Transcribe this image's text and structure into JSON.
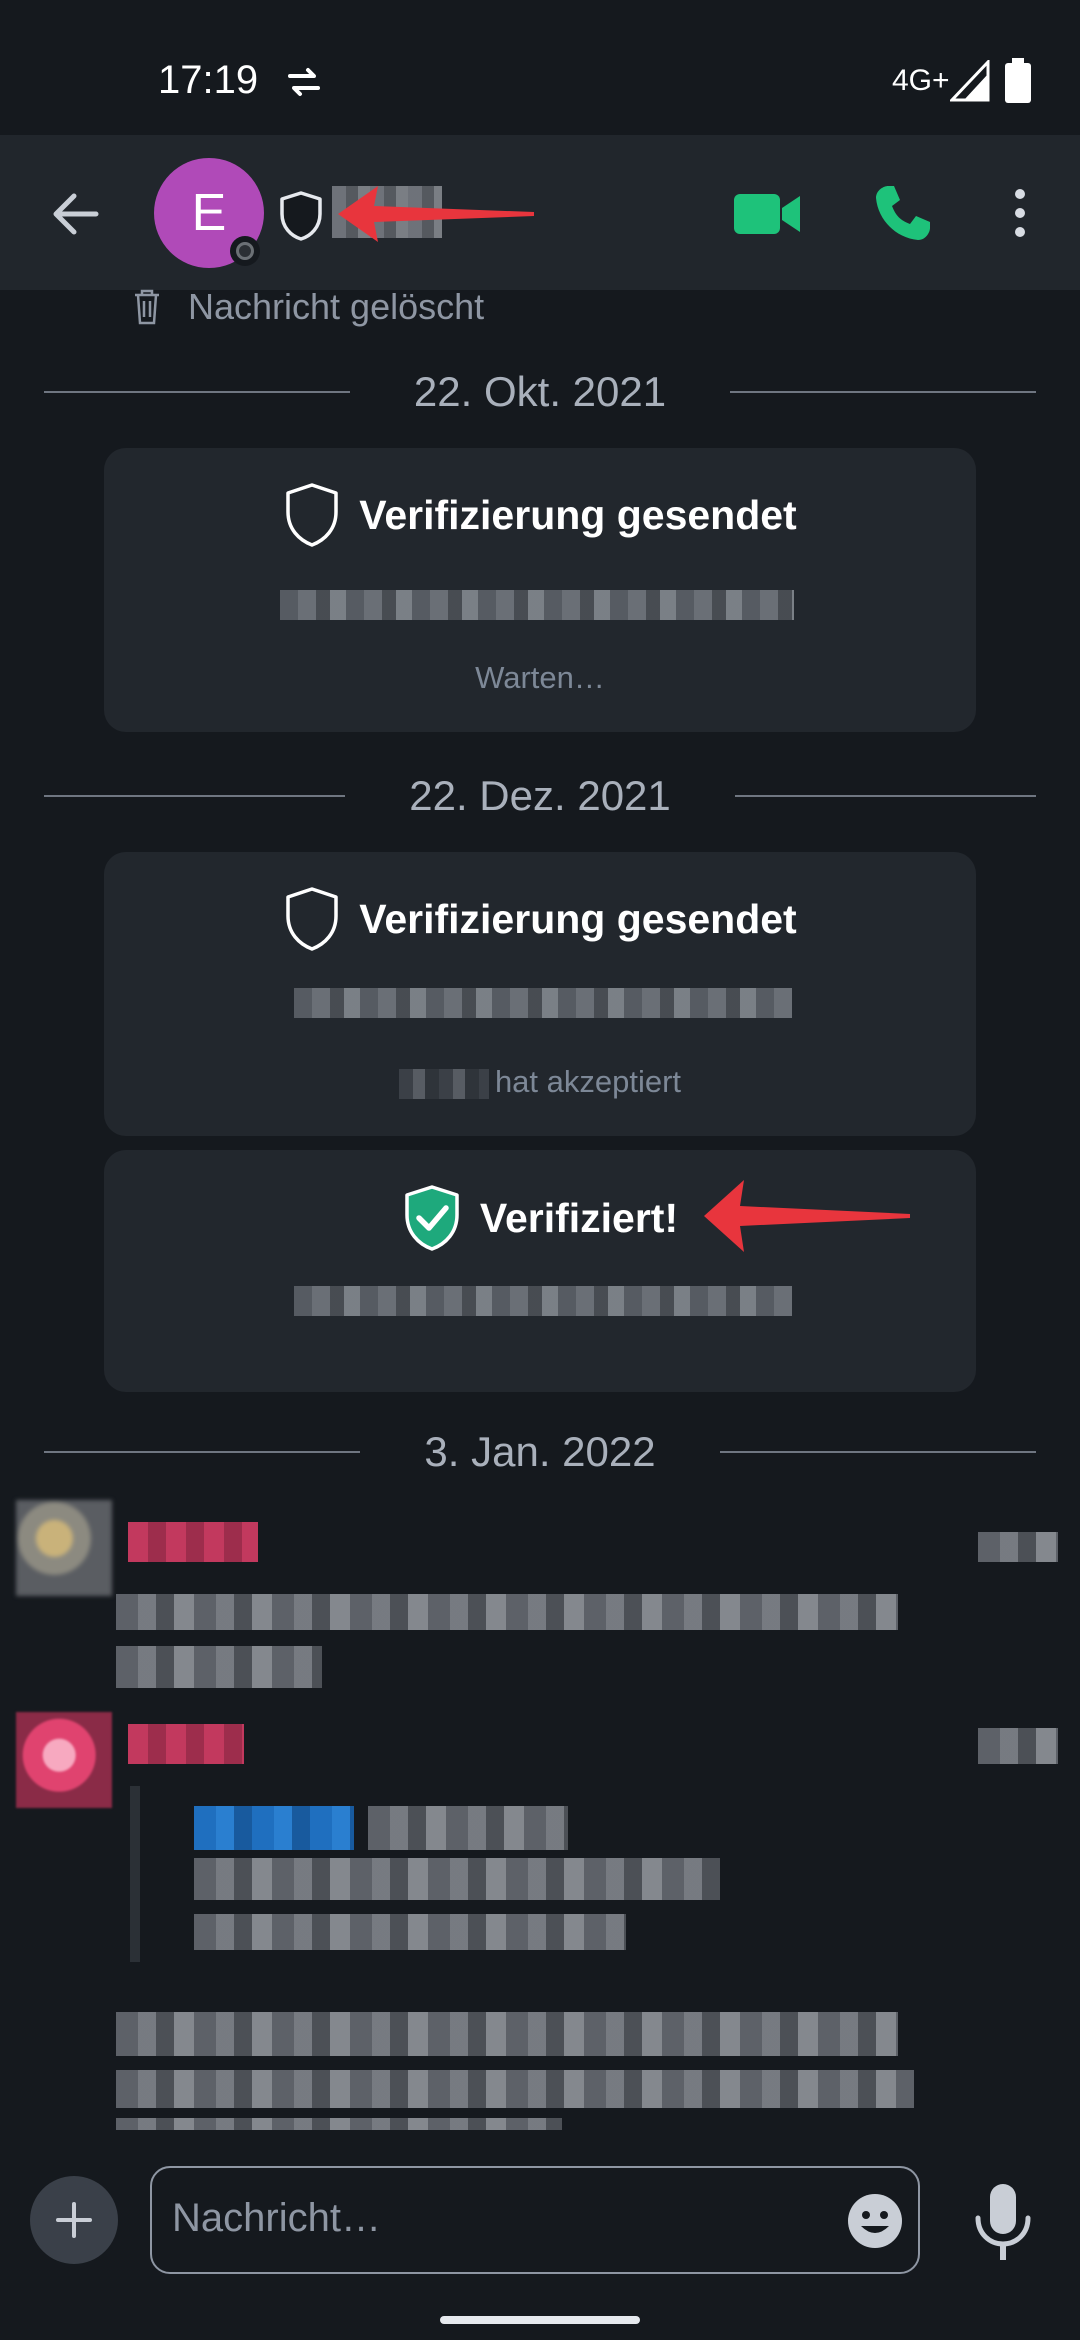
{
  "status_bar": {
    "time": "17:19",
    "network": "4G+",
    "icons": [
      "sync-icon",
      "signal-icon",
      "battery-icon"
    ]
  },
  "header": {
    "avatar_letter": "E",
    "icons": [
      "back-arrow-icon",
      "shield-icon",
      "video-call-icon",
      "phone-icon",
      "more-vert-icon"
    ],
    "accent": "#1ec27a",
    "avatar_color": "#b04ab8"
  },
  "chat": {
    "deleted_message": "Nachricht gelöscht",
    "dates": [
      "22. Okt. 2021",
      "22. Dez. 2021",
      "3. Jan. 2022"
    ],
    "cards": [
      {
        "title": "Verifizierung gesendet",
        "status": "Warten…"
      },
      {
        "title": "Verifizierung gesendet",
        "status": "hat akzeptiert"
      },
      {
        "title": "Verifiziert!",
        "status": ""
      }
    ]
  },
  "composer": {
    "placeholder": "Nachricht…",
    "icons": [
      "plus-icon",
      "emoji-icon",
      "microphone-icon"
    ]
  },
  "colors": {
    "background": "#15191e",
    "card": "#22272d",
    "verified_green": "#1ea97c",
    "annotation_arrow": "#e8353d"
  }
}
